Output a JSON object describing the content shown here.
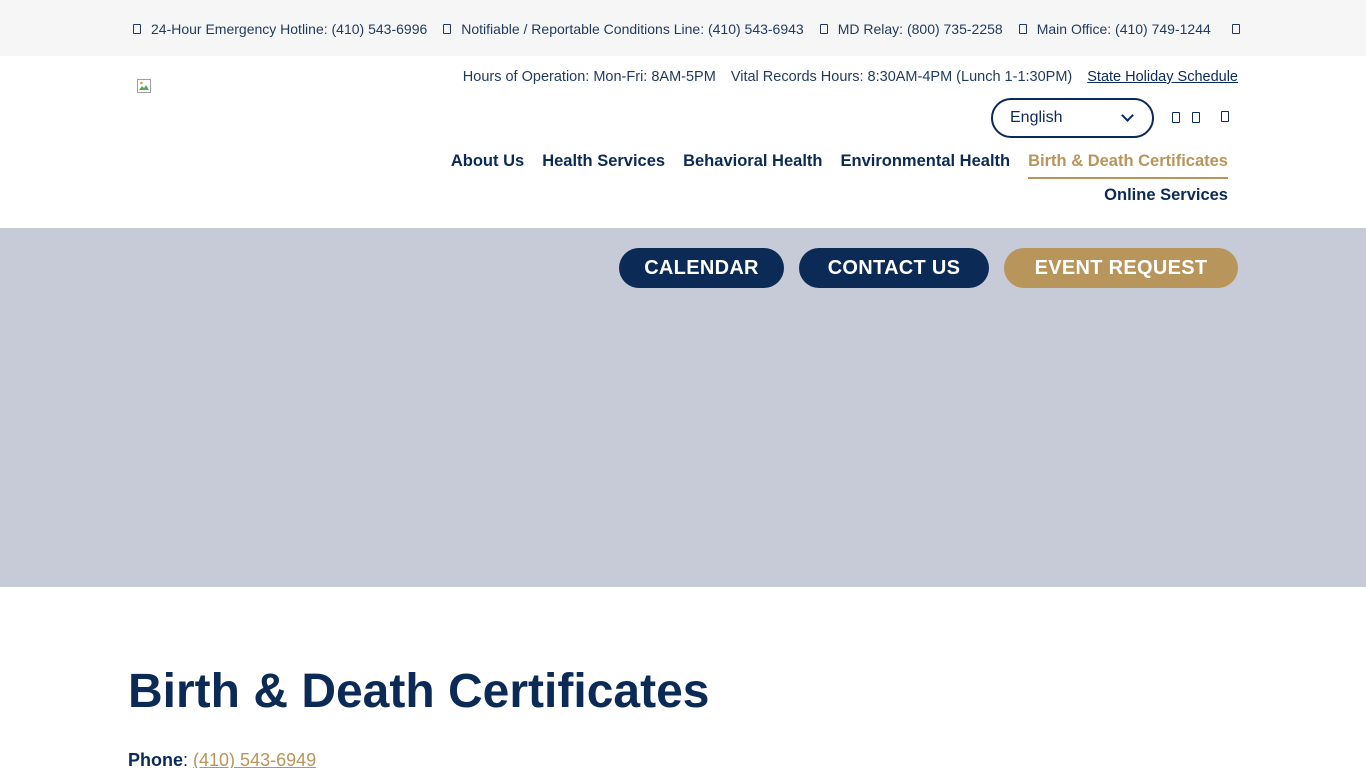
{
  "topbar": {
    "items": [
      {
        "icon": "phone-icon",
        "label": "24-Hour Emergency Hotline: (410) 543-6996"
      },
      {
        "icon": "phone-icon",
        "label": "Notifiable / Reportable Conditions Line: (410) 543-6943"
      },
      {
        "icon": "phone-icon",
        "label": "MD Relay: (800) 735-2258"
      },
      {
        "icon": "phone-icon",
        "label": "Main Office: (410) 749-1244"
      }
    ],
    "trailing_icon": "search-icon"
  },
  "header": {
    "hours": "Hours of Operation: Mon-Fri: 8AM-5PM",
    "vital_hours": "Vital Records Hours: 8:30AM-4PM (Lunch 1-1:30PM)",
    "holiday_link": "State Holiday Schedule",
    "language": "English",
    "social_icons": [
      "facebook-icon",
      "twitter-icon",
      "instagram-icon"
    ]
  },
  "nav": {
    "items": [
      "About Us",
      "Health Services",
      "Behavioral Health",
      "Environmental Health",
      "Birth & Death Certificates"
    ],
    "active": "Birth & Death Certificates",
    "second_row": "Online Services"
  },
  "hero": {
    "buttons": {
      "calendar": "CALENDAR",
      "contact": "CONTACT US",
      "event": "EVENT REQUEST"
    }
  },
  "main": {
    "title": "Birth & Death Certificates",
    "phone_label": "Phone",
    "phone_value": "(410) 543-6949"
  },
  "colors": {
    "navy": "#0b2a55",
    "gold": "#b8955a",
    "hero_bg": "#c7cbd8",
    "topbar_bg": "#f6f6f6"
  }
}
